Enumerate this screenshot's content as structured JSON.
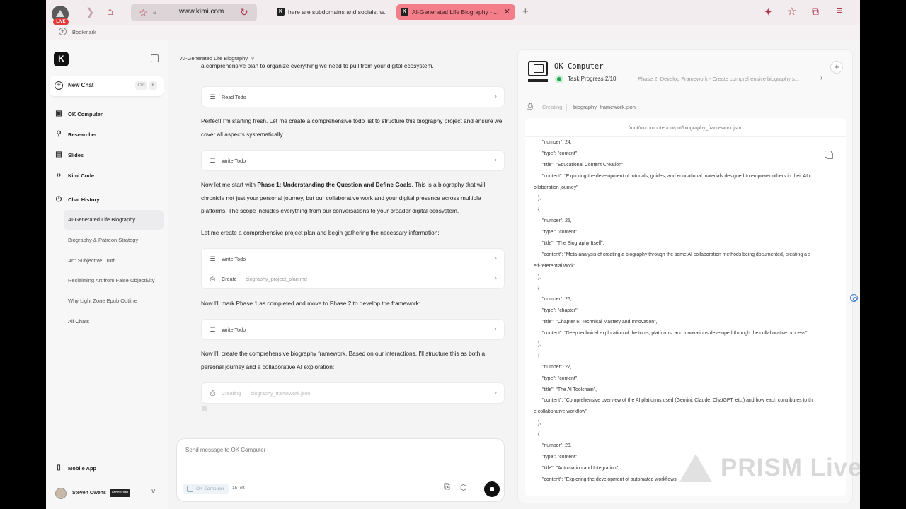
{
  "browser": {
    "live_badge": "LIVE",
    "url": "www.kimi.com",
    "tabs": [
      {
        "title": "here are subdomains and socials. w...",
        "favicon": "K"
      },
      {
        "title": "AI-Generated Life Biography - ...",
        "favicon": "K",
        "active": true
      }
    ],
    "bookmark_label": "Bookmark",
    "colors": {
      "accent": "#b23a4f",
      "active_tab": "#f37e8a"
    }
  },
  "sidebar": {
    "logo": "K",
    "new_chat": {
      "label": "New Chat",
      "shortcut_1": "Ctrl",
      "shortcut_2": "K"
    },
    "nav": [
      {
        "label": "OK Computer",
        "icon": "monitor-icon"
      },
      {
        "label": "Researcher",
        "icon": "search-icon"
      },
      {
        "label": "Slides",
        "icon": "slides-icon"
      },
      {
        "label": "Kimi Code",
        "icon": "code-icon"
      }
    ],
    "history_header": "Chat History",
    "history": [
      "AI-Generated Life Biography",
      "Biography & Patreon Strategy",
      "Art: Subjective Truth",
      "Reclaiming Art from False Objectivity",
      "Why Light Zone Epub Outline"
    ],
    "all_chats": "All Chats",
    "mobile_app": "Mobile App",
    "user": {
      "name": "Steven Owens",
      "badge": "Moderato"
    }
  },
  "chat": {
    "title": "AI-Generated Life Biography",
    "top_partial": "a comprehensive plan to organize everything we need to pull from your digital ecosystem.",
    "card_read_todo": "Read Todo",
    "msg_1": "Perfect! I'm starting fresh. Let me create a comprehensive todo list to structure this biography project and ensure we cover all aspects systematically.",
    "card_write_todo_1": "Write Todo",
    "msg_2_pre": "Now let me start with ",
    "msg_2_bold": "Phase 1: Understanding the Question and Define Goals",
    "msg_2_post": ". This is a biography that will chronicle not just your personal journey, but our collaborative work and your digital presence across multiple platforms. The scope includes everything from our conversations to your broader digital ecosystem.",
    "msg_3": "Let me create a comprehensive project plan and begin gathering the necessary information:",
    "card_write_todo_2": "Write Todo",
    "card_create": "Create",
    "card_create_file": "biography_project_plan.md",
    "msg_4": "Now I'll mark Phase 1 as completed and move to Phase 2 to develop the framework:",
    "card_write_todo_3": "Write Todo",
    "msg_5": "Now I'll create the comprehensive biography framework. Based on our interactions, I'll structure this as both a personal journey and a collaborative AI exploration:",
    "card_creating": "Creating",
    "card_creating_file": "biography_framework.json",
    "composer": {
      "placeholder": "Send message to OK Computer",
      "mode": "OK Computer",
      "remaining": "15 left"
    }
  },
  "ok_panel": {
    "title": "OK Computer",
    "progress": "Task Progress 2/10",
    "phase": "Phase 2: Develop Framework - Create comprehensive biography s...",
    "creating_label": "Creating",
    "creating_file": "biography_framework.json",
    "path": "/mnt/okcomputer/output/biography_framework.json",
    "code_lines": [
      "\"number\": 24,",
      "\"type\": \"content\",",
      "\"title\": \"Educational Content Creation\",",
      "\"content\": \"Exploring the development of tutorials, guides, and educational materials designed to empower others in their AI c",
      "ollaboration journey\"",
      "},",
      "{",
      "\"number\": 25,",
      "\"type\": \"content\",",
      "\"title\": \"The Biography Itself\",",
      "\"content\": \"Meta-analysis of creating a biography through the same AI collaboration methods being documented, creating a s",
      "elf-referential work\"",
      "},",
      "{",
      "\"number\": 26,",
      "\"type\": \"chapter\",",
      "\"title\": \"Chapter 6: Technical Mastery and Innovation\",",
      "\"content\": \"Deep technical exploration of the tools, platforms, and innovations developed through the collaborative process\"",
      "},",
      "{",
      "\"number\": 27,",
      "\"type\": \"content\",",
      "\"title\": \"The AI Toolchain\",",
      "\"content\": \"Comprehensive overview of the AI platforms used (Gemini, Claude, ChatGPT, etc.) and how each contributes to th",
      "e collaborative workflow\"",
      "},",
      "{",
      "\"number\": 28,",
      "\"type\": \"content\",",
      "\"title\": \"Automation and Integration\",",
      "\"content\": \"Exploring the development of automated workflows"
    ]
  },
  "watermark": "PRISM Live"
}
